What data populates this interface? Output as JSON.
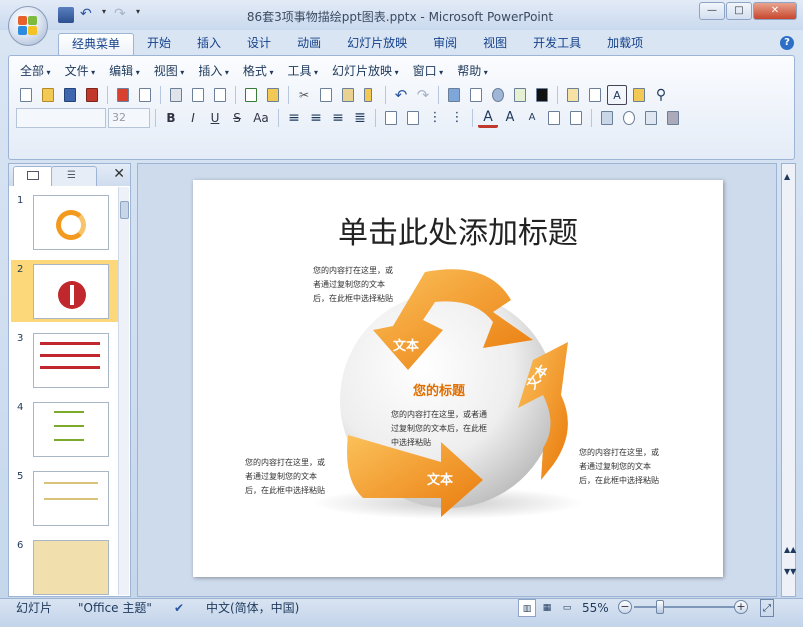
{
  "window": {
    "title": "86套3项事物描绘ppt图表.pptx - Microsoft PowerPoint",
    "minimize": "—",
    "maximize": "□",
    "close": "✕"
  },
  "tabs": [
    "经典菜单",
    "开始",
    "插入",
    "设计",
    "动画",
    "幻灯片放映",
    "审阅",
    "视图",
    "开发工具",
    "加载项"
  ],
  "menu": [
    "全部",
    "文件",
    "编辑",
    "视图",
    "插入",
    "格式",
    "工具",
    "幻灯片放映",
    "窗口",
    "帮助"
  ],
  "font": {
    "name": "",
    "size": "32"
  },
  "format_buttons": {
    "bold": "B",
    "italic": "I",
    "underline": "U",
    "strike": "S",
    "case": "Aa"
  },
  "slide": {
    "title": "单击此处添加标题",
    "arrow_labels": [
      "文本",
      "文本",
      "文本"
    ],
    "center_title": "您的标题",
    "center_text": [
      "您的内容打在这里，或者通",
      "过复制您的文本后，在此框",
      "中选择粘贴"
    ],
    "text_top": [
      "您的内容打在这里，或",
      "者通过复制您的文本",
      "后，在此框中选择粘贴"
    ],
    "text_bottom_left": [
      "您的内容打在这里，或",
      "者通过复制您的文本",
      "后，在此框中选择粘贴"
    ],
    "text_right": [
      "您的内容打在这里，或",
      "者通过复制您的文本",
      "后，在此框中选择粘贴"
    ]
  },
  "thumbnails": [
    {
      "num": "1"
    },
    {
      "num": "2"
    },
    {
      "num": "3"
    },
    {
      "num": "4"
    },
    {
      "num": "5"
    },
    {
      "num": "6"
    }
  ],
  "statusbar": {
    "view": "幻灯片",
    "theme": "\"Office 主题\"",
    "language": "中文(简体，中国)",
    "zoom": "55%"
  },
  "colors": {
    "accent_orange": "#f39a1e",
    "ribbon_blue": "#c5d6ec",
    "selected_thumb": "#fcd87a",
    "title_text": "#e16f00"
  }
}
